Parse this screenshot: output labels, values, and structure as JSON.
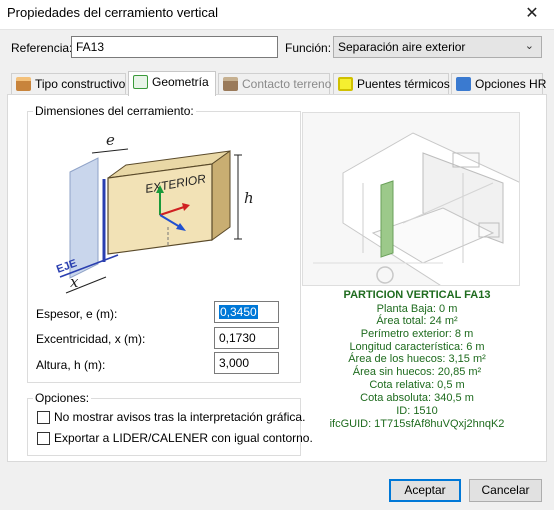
{
  "window": {
    "title": "Propiedades del cerramiento vertical",
    "close_glyph": "✕"
  },
  "form": {
    "referencia_label": "Referencia:",
    "referencia_value": "FA13",
    "funcion_label": "Función:",
    "funcion_value": "Separación aire exterior"
  },
  "tabs": [
    {
      "label": "Tipo constructivo",
      "icon": "brick-icon",
      "color": "#c8843c"
    },
    {
      "label": "Geometría",
      "icon": "geometry-icon",
      "color": "#3a9a3a"
    },
    {
      "label": "Contacto terreno",
      "icon": "terrain-icon",
      "color": "#9a7a5a"
    },
    {
      "label": "Puentes térmicos",
      "icon": "thermal-bridge-icon",
      "color": "#e8d400"
    },
    {
      "label": "Opciones HR",
      "icon": "hr-options-icon",
      "color": "#3a7ad0"
    }
  ],
  "dimensions": {
    "group_title": "Dimensiones del cerramiento:",
    "diagram": {
      "exterior": "EXTERIOR",
      "eje": "EJE",
      "e": "e",
      "x": "x",
      "h": "h"
    },
    "espesor_label": "Espesor, e (m):",
    "espesor_value": "0,3450",
    "excentricidad_label": "Excentricidad, x (m):",
    "excentricidad_value": "0,1730",
    "altura_label": "Altura, h (m):",
    "altura_value": "3,000"
  },
  "options": {
    "group_title": "Opciones:",
    "opt1": "No mostrar avisos tras la interpretación gráfica.",
    "opt2": "Exportar a LIDER/CALENER con igual contorno.",
    "opt1_checked": false,
    "opt2_checked": false
  },
  "info": {
    "title": "PARTICION VERTICAL FA13",
    "lines": [
      "Planta Baja: 0 m",
      "Área total: 24 m²",
      "Perímetro exterior: 8 m",
      "Longitud característica: 6 m",
      "Área de los huecos: 3,15 m²",
      "Área sin huecos: 20,85 m²",
      "Cota relativa: 0,5 m",
      "Cota absoluta: 340,5 m",
      "ID: 1510",
      "ifcGUID: 1T715sfAf8huVQxj2hnqK2"
    ]
  },
  "buttons": {
    "accept": "Aceptar",
    "cancel": "Cancelar"
  }
}
